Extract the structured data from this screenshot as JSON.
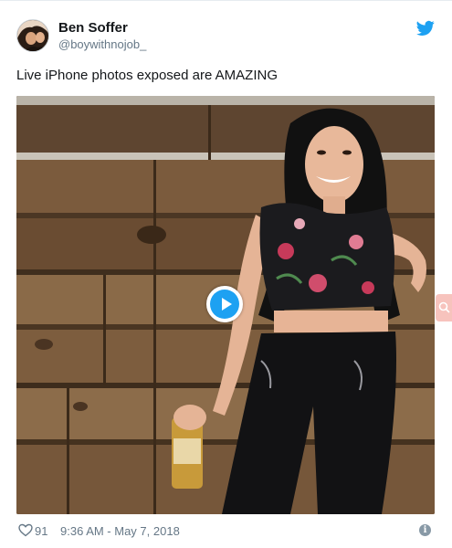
{
  "user": {
    "display_name": "Ben Soffer",
    "username": "@boywithnojob_"
  },
  "tweet": {
    "text": "Live iPhone photos exposed are AMAZING"
  },
  "media": {
    "type": "video",
    "play_icon": "play-icon",
    "accent_color": "#1da1f2"
  },
  "footer": {
    "like_count": "91",
    "timestamp": "9:36 AM - May 7, 2018",
    "info_icon": "info-icon"
  },
  "icons": {
    "brand": "twitter-bird-icon",
    "brand_color": "#1da1f2",
    "like": "heart-icon",
    "side_tab": "search-icon"
  }
}
